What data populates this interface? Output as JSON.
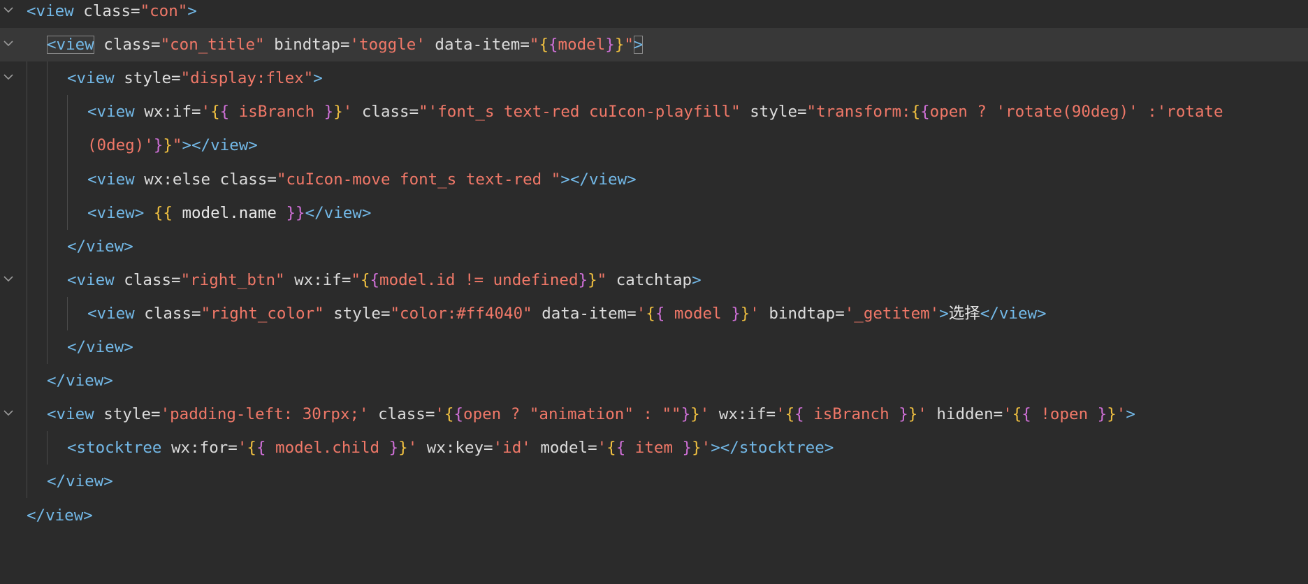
{
  "editor": {
    "lines": [
      {
        "indent": 0,
        "fold": true,
        "current": false,
        "tokens": [
          [
            "tag",
            "<view"
          ],
          [
            "attr",
            " class="
          ],
          [
            "str",
            "\"con\""
          ],
          [
            "tag",
            ">"
          ]
        ]
      },
      {
        "indent": 1,
        "fold": true,
        "current": true,
        "tokens": [
          [
            "tag",
            "<view"
          ],
          [
            "attr",
            " class="
          ],
          [
            "str",
            "\"con_title\""
          ],
          [
            "attr",
            " bindtap="
          ],
          [
            "str",
            "'toggle'"
          ],
          [
            "attr",
            " data-item="
          ],
          [
            "str",
            "\""
          ],
          [
            "brace1",
            "{"
          ],
          [
            "brace2",
            "{"
          ],
          [
            "str",
            "model"
          ],
          [
            "brace2",
            "}"
          ],
          [
            "brace1",
            "}"
          ],
          [
            "str",
            "\""
          ],
          [
            "tag",
            ">"
          ]
        ]
      },
      {
        "indent": 2,
        "fold": true,
        "current": false,
        "tokens": [
          [
            "tag",
            "<view"
          ],
          [
            "attr",
            " style="
          ],
          [
            "str",
            "\"display:flex\""
          ],
          [
            "tag",
            ">"
          ]
        ]
      },
      {
        "indent": 3,
        "fold": false,
        "current": false,
        "tokens": [
          [
            "tag",
            "<view"
          ],
          [
            "attr",
            " wx:if="
          ],
          [
            "str",
            "'"
          ],
          [
            "brace1",
            "{"
          ],
          [
            "brace2",
            "{"
          ],
          [
            "str",
            " isBranch "
          ],
          [
            "brace2",
            "}"
          ],
          [
            "brace1",
            "}"
          ],
          [
            "str",
            "'"
          ],
          [
            "attr",
            " class="
          ],
          [
            "str",
            "\"'font_s text-red cuIcon-playfill\""
          ],
          [
            "attr",
            " style="
          ],
          [
            "str",
            "\"transform:"
          ],
          [
            "brace1",
            "{"
          ],
          [
            "brace2",
            "{"
          ],
          [
            "str",
            "open ? 'rotate(90deg)' :'rotate"
          ]
        ]
      },
      {
        "indent": 3,
        "fold": false,
        "current": false,
        "tokens": [
          [
            "str",
            "(0deg)'"
          ],
          [
            "brace2",
            "}"
          ],
          [
            "brace1",
            "}"
          ],
          [
            "str",
            "\""
          ],
          [
            "tag",
            "></view>"
          ]
        ]
      },
      {
        "indent": 3,
        "fold": false,
        "current": false,
        "tokens": [
          [
            "tag",
            "<view"
          ],
          [
            "attr",
            " wx:else class="
          ],
          [
            "str",
            "\"cuIcon-move font_s text-red \""
          ],
          [
            "tag",
            "></view>"
          ]
        ]
      },
      {
        "indent": 3,
        "fold": false,
        "current": false,
        "tokens": [
          [
            "tag",
            "<view>"
          ],
          [
            "text",
            " "
          ],
          [
            "brace1",
            "{{"
          ],
          [
            "text",
            " model.name "
          ],
          [
            "brace2",
            "}}"
          ],
          [
            "tag",
            "</view>"
          ]
        ]
      },
      {
        "indent": 2,
        "fold": false,
        "current": false,
        "tokens": [
          [
            "tag",
            "</view>"
          ]
        ]
      },
      {
        "indent": 2,
        "fold": true,
        "current": false,
        "tokens": [
          [
            "tag",
            "<view"
          ],
          [
            "attr",
            " class="
          ],
          [
            "str",
            "\"right_btn\""
          ],
          [
            "attr",
            " wx:if="
          ],
          [
            "str",
            "\""
          ],
          [
            "brace1",
            "{"
          ],
          [
            "brace2",
            "{"
          ],
          [
            "str",
            "model.id != undefined"
          ],
          [
            "brace2",
            "}"
          ],
          [
            "brace1",
            "}"
          ],
          [
            "str",
            "\""
          ],
          [
            "attr",
            " catchtap"
          ],
          [
            "tag",
            ">"
          ]
        ]
      },
      {
        "indent": 3,
        "fold": false,
        "current": false,
        "tokens": [
          [
            "tag",
            "<view"
          ],
          [
            "attr",
            " class="
          ],
          [
            "str",
            "\"right_color\""
          ],
          [
            "attr",
            " style="
          ],
          [
            "str",
            "\"color:#ff4040\""
          ],
          [
            "attr",
            " data-item="
          ],
          [
            "str",
            "'"
          ],
          [
            "brace1",
            "{"
          ],
          [
            "brace2",
            "{"
          ],
          [
            "str",
            " model "
          ],
          [
            "brace2",
            "}"
          ],
          [
            "brace1",
            "}"
          ],
          [
            "str",
            "'"
          ],
          [
            "attr",
            " bindtap="
          ],
          [
            "str",
            "'_getitem'"
          ],
          [
            "tag",
            ">"
          ],
          [
            "text",
            "选择"
          ],
          [
            "tag",
            "</view>"
          ]
        ]
      },
      {
        "indent": 2,
        "fold": false,
        "current": false,
        "tokens": [
          [
            "tag",
            "</view>"
          ]
        ]
      },
      {
        "indent": 1,
        "fold": false,
        "current": false,
        "tokens": [
          [
            "tag",
            "</view>"
          ]
        ]
      },
      {
        "indent": 1,
        "fold": true,
        "current": false,
        "tokens": [
          [
            "tag",
            "<view"
          ],
          [
            "attr",
            " style="
          ],
          [
            "str",
            "'padding-left: 30rpx;'"
          ],
          [
            "attr",
            " class="
          ],
          [
            "str",
            "'"
          ],
          [
            "brace1",
            "{"
          ],
          [
            "brace2",
            "{"
          ],
          [
            "str",
            "open ? \"animation\" : \"\""
          ],
          [
            "brace2",
            "}"
          ],
          [
            "brace1",
            "}"
          ],
          [
            "str",
            "'"
          ],
          [
            "attr",
            " wx:if="
          ],
          [
            "str",
            "'"
          ],
          [
            "brace1",
            "{"
          ],
          [
            "brace2",
            "{"
          ],
          [
            "str",
            " isBranch "
          ],
          [
            "brace2",
            "}"
          ],
          [
            "brace1",
            "}"
          ],
          [
            "str",
            "'"
          ],
          [
            "attr",
            " hidden="
          ],
          [
            "str",
            "'"
          ],
          [
            "brace1",
            "{"
          ],
          [
            "brace2",
            "{"
          ],
          [
            "str",
            " !open "
          ],
          [
            "brace2",
            "}"
          ],
          [
            "brace1",
            "}"
          ],
          [
            "str",
            "'"
          ],
          [
            "tag",
            ">"
          ]
        ]
      },
      {
        "indent": 2,
        "fold": false,
        "current": false,
        "tokens": [
          [
            "tag",
            "<stocktree"
          ],
          [
            "attr",
            " wx:for="
          ],
          [
            "str",
            "'"
          ],
          [
            "brace1",
            "{"
          ],
          [
            "brace2",
            "{"
          ],
          [
            "str",
            " model.child "
          ],
          [
            "brace2",
            "}"
          ],
          [
            "brace1",
            "}"
          ],
          [
            "str",
            "'"
          ],
          [
            "attr",
            " wx:key="
          ],
          [
            "str",
            "'id'"
          ],
          [
            "attr",
            " model="
          ],
          [
            "str",
            "'"
          ],
          [
            "brace1",
            "{"
          ],
          [
            "brace2",
            "{"
          ],
          [
            "str",
            " item "
          ],
          [
            "brace2",
            "}"
          ],
          [
            "brace1",
            "}"
          ],
          [
            "str",
            "'"
          ],
          [
            "tag",
            "></stocktree>"
          ]
        ]
      },
      {
        "indent": 1,
        "fold": false,
        "current": false,
        "tokens": [
          [
            "tag",
            "</view>"
          ]
        ]
      },
      {
        "indent": 0,
        "fold": false,
        "current": false,
        "tokens": [
          [
            "tag",
            "</view>"
          ]
        ]
      }
    ]
  }
}
